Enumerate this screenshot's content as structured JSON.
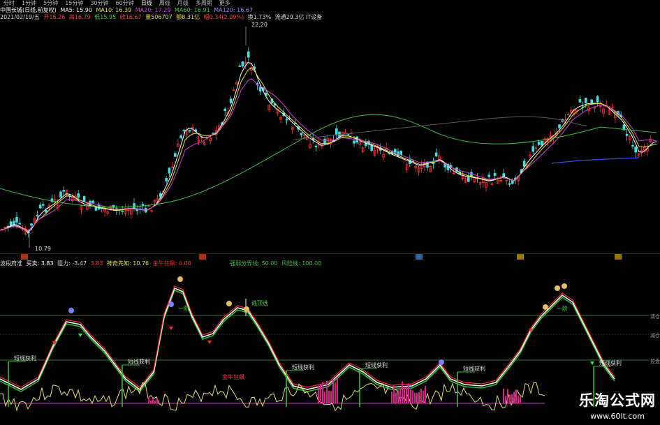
{
  "tabs": [
    "分时",
    "1分钟",
    "5分钟",
    "15分钟",
    "30分钟",
    "60分钟",
    "日线",
    "周线",
    "月线",
    "多周期",
    "更多"
  ],
  "active_tab": 6,
  "title_line": {
    "stock": "中国长城(日线,前复权)",
    "ma5": "MA5: 15.90",
    "ma10": "MA10: 16.39",
    "ma20": "MA20: 17.29",
    "ma60": "MA60: 16.91",
    "ma120": "MA120: 16.67"
  },
  "quote_line": {
    "date": "2021/02/19/五",
    "open": "开16.26",
    "high": "高16.79",
    "low": "低15.95",
    "close": "收16.67",
    "volume": "量506707",
    "amount": "额8.31亿",
    "change": "幅0.34(2.09%)",
    "turnover": "换1.73%",
    "float": "流通29.3亿 IT设备"
  },
  "price_labels": {
    "high": "22.20",
    "low": "10.79"
  },
  "indicator_line": {
    "name": "波段府准",
    "buysell": "买卖: 3.83",
    "resist": "阻力: -3.47",
    "val3": "3.83",
    "shen": "神奇先知: 10.76",
    "jinniu": "金牛狂飙: 0.00",
    "qiang": "强弱分界线: 50.00",
    "fengxian": "风险线: 100.00"
  },
  "right_labels": {
    "top": "清仓",
    "mid": "减仓",
    "bot": "控盘"
  },
  "annotations": {
    "profit": "短线获利",
    "jinniu_ann": "金牛狂飙",
    "shenggou": "逃顶选",
    "yijie": "一阶"
  },
  "watermark": {
    "title": "乐淘公式网",
    "url": "www.60lt.com"
  },
  "colors": {
    "up": "#ff3030",
    "down": "#40e0e0",
    "ma5": "#ffffff",
    "ma10": "#e8e040",
    "ma20": "#d040d0",
    "ma60": "#40c040",
    "ma120": "#3050ff"
  }
}
